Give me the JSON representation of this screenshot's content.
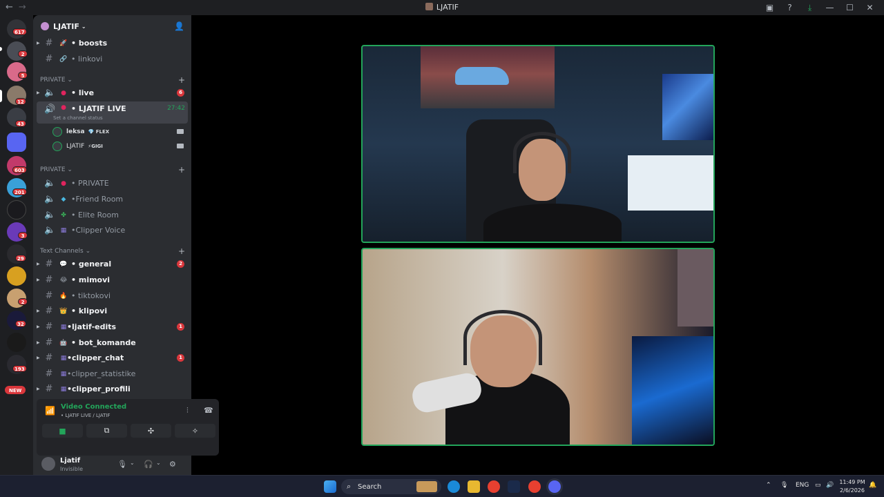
{
  "window": {
    "title": "LJATIF"
  },
  "rail": {
    "badges": [
      "617",
      "2",
      "5",
      "12",
      "43",
      "603",
      "201",
      "3",
      "29",
      "2",
      "32",
      "193",
      "NEW"
    ]
  },
  "guild": {
    "name": "LJATIF"
  },
  "channels_top": [
    {
      "emoji": "🚀",
      "label": "• boosts",
      "bold": true
    },
    {
      "emoji": "🔗",
      "label": "• linkovi",
      "bold": false
    }
  ],
  "category_private1": "PRIVATE",
  "voice_channels1": [
    {
      "label": "• live",
      "bold": true,
      "count": "6"
    },
    {
      "label": "• LJATIF LIVE",
      "bold": true,
      "time": "27:42",
      "sub": "Set a channel status"
    }
  ],
  "voice_users": [
    {
      "name": "leksa",
      "tag": "💎 FLEX"
    },
    {
      "name": "LJATIF",
      "tag": "⚡GIGI"
    }
  ],
  "category_private2": "PRIVATE",
  "voice_channels2": [
    {
      "label": "• PRIVATE"
    },
    {
      "label": "•Friend Room"
    },
    {
      "label": "• Elite Room"
    },
    {
      "label": "•Clipper Voice"
    }
  ],
  "category_text": "Text Channels",
  "text_channels": [
    {
      "label": "• general",
      "bold": true,
      "count": "2"
    },
    {
      "label": "• mimovi",
      "bold": true
    },
    {
      "label": "• tiktokovi",
      "bold": false
    },
    {
      "label": "• klipovi",
      "bold": true
    },
    {
      "label": "•ljatif-edits",
      "bold": true,
      "count": "1"
    },
    {
      "label": "• bot_komande",
      "bold": true
    },
    {
      "label": "•clipper_chat",
      "bold": true,
      "count": "1"
    },
    {
      "label": "•clipper_statistike",
      "bold": false
    },
    {
      "label": "•clipper_profili",
      "bold": true
    }
  ],
  "voice_panel": {
    "status": "Video Connected",
    "where": "• LJATIF LIVE / LJATIF"
  },
  "userbar": {
    "name": "Ljatif",
    "status": "Invisible"
  },
  "taskbar": {
    "search_label": "Search",
    "lang": "ENG",
    "time": "11:49 PM",
    "date": "2/6/2026"
  }
}
